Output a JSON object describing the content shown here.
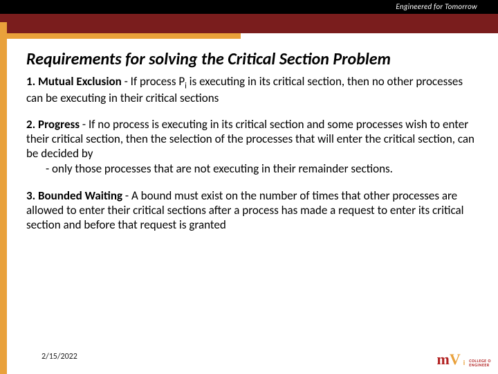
{
  "header": {
    "tagline": "Engineered for Tomorrow"
  },
  "title": "Requirements for solving the Critical Section Problem",
  "items": [
    {
      "num": "1.",
      "lead": "Mutual Exclusion",
      "body_pre": " - If process P",
      "body_sub": "i",
      "body_post": " is executing in its critical section, then no other processes can be executing in their critical sections"
    },
    {
      "num": "2.",
      "lead": "Progress",
      "body": " - If no process is executing in its critical section and some processes wish to enter their critical section, then the selection of the processes that will enter the critical section, can be decided by",
      "sub_bullet": "-   only those processes that are not executing in their remainder sections."
    },
    {
      "num": "3.",
      "lead": "Bounded Waiting",
      "body": " -  A bound must exist on the number of times that other processes are allowed to enter their critical sections after a process has made a request to enter its critical section and before that request is granted"
    }
  ],
  "footer": {
    "date": "2/15/2022"
  },
  "logo": {
    "line1": "COLLEGE O",
    "line2": "ENGINEER"
  }
}
